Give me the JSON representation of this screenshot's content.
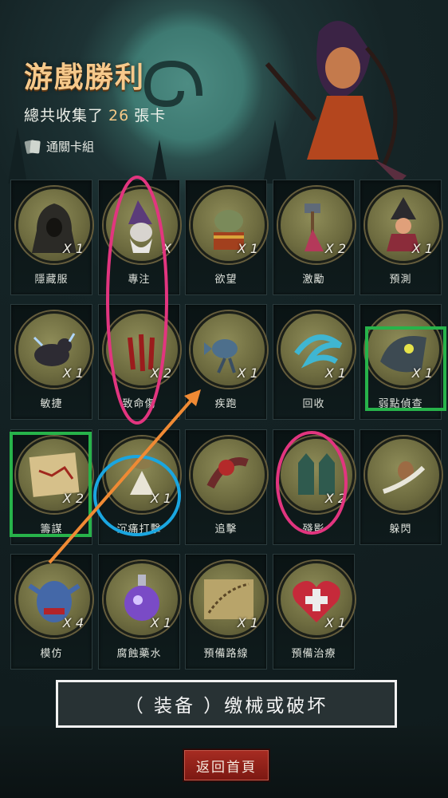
{
  "header": {
    "title": "游戲勝利",
    "subtitle_prefix": "總共收集了",
    "card_count": "26",
    "subtitle_suffix": "張卡",
    "deck_link": "通關卡組"
  },
  "cards": [
    {
      "name": "隱藏服",
      "count": "X 1",
      "icon": "hooded-figure"
    },
    {
      "name": "專注",
      "count": "X",
      "icon": "wizard"
    },
    {
      "name": "欲望",
      "count": "X 1",
      "icon": "treasure-goblin"
    },
    {
      "name": "激勵",
      "count": "X 2",
      "icon": "hammer-warrior"
    },
    {
      "name": "預測",
      "count": "X 1",
      "icon": "witch"
    },
    {
      "name": "敏捷",
      "count": "X 1",
      "icon": "panther"
    },
    {
      "name": "致命傷",
      "count": "X 2",
      "icon": "bleeding-wounds"
    },
    {
      "name": "疾跑",
      "count": "X 1",
      "icon": "running-fish"
    },
    {
      "name": "回收",
      "count": "X 1",
      "icon": "swirl"
    },
    {
      "name": "弱點偵查",
      "count": "X 1",
      "icon": "wolf-eye"
    },
    {
      "name": "籌謀",
      "count": "X 2",
      "icon": "map-plan"
    },
    {
      "name": "沉痛打擊",
      "count": "X 1",
      "icon": "smash"
    },
    {
      "name": "追擊",
      "count": "",
      "icon": "chase"
    },
    {
      "name": "殘影",
      "count": "X 2",
      "icon": "shadow-clones"
    },
    {
      "name": "躲閃",
      "count": "",
      "icon": "dodge"
    },
    {
      "name": "模仿",
      "count": "X 4",
      "icon": "goblin-mask"
    },
    {
      "name": "腐蝕藥水",
      "count": "X 1",
      "icon": "potion"
    },
    {
      "name": "預備路線",
      "count": "X 1",
      "icon": "route-map"
    },
    {
      "name": "預備治療",
      "count": "X 1",
      "icon": "heart-cross"
    }
  ],
  "tip_text": "（ 装备 ）缴械或破坏",
  "home_button": "返回首頁",
  "colors": {
    "title": "#f6c98b",
    "annotation_pink": "#e2357f",
    "annotation_green": "#27b34a",
    "annotation_blue": "#1aa6e0",
    "annotation_orange": "#f08a34",
    "button_red": "#9a2419"
  }
}
